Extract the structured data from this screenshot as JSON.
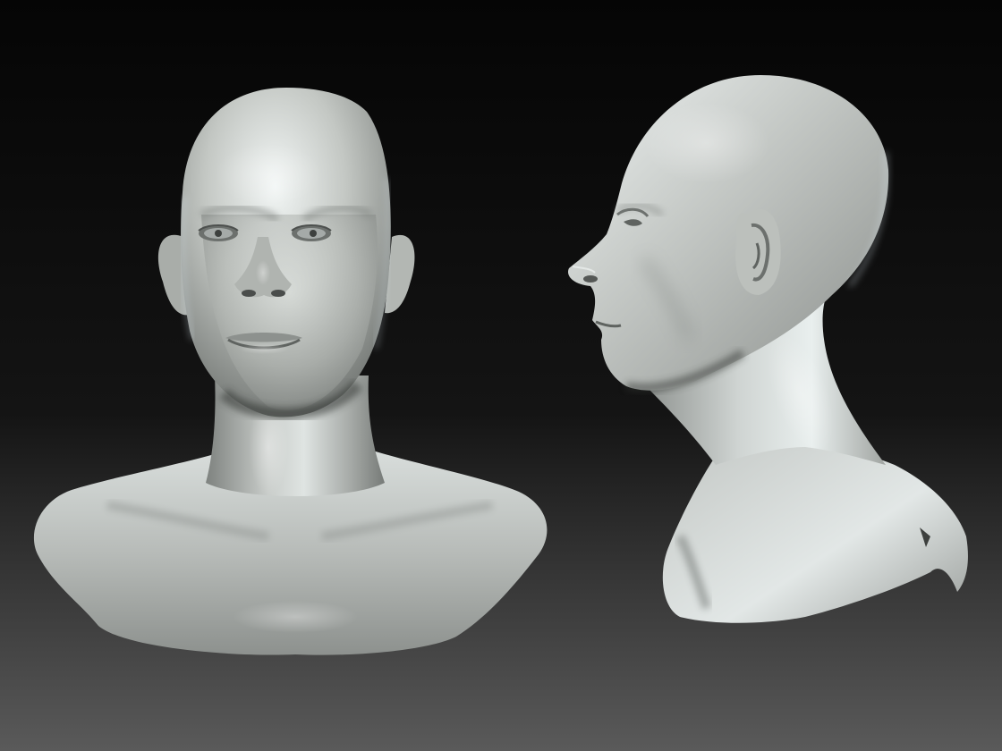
{
  "scene": {
    "background": {
      "top_color": "#050505",
      "mid_color": "#141414",
      "bottom_color": "#5a5a5a"
    },
    "material": {
      "base": "#b8bcb8",
      "highlight": "#e8eeee",
      "rim": "#d9e6ee",
      "shadow": "#5f6360",
      "deep_shadow": "#2e302f"
    },
    "views": [
      {
        "id": "front-view",
        "label": "front"
      },
      {
        "id": "side-view",
        "label": "profile"
      }
    ]
  }
}
